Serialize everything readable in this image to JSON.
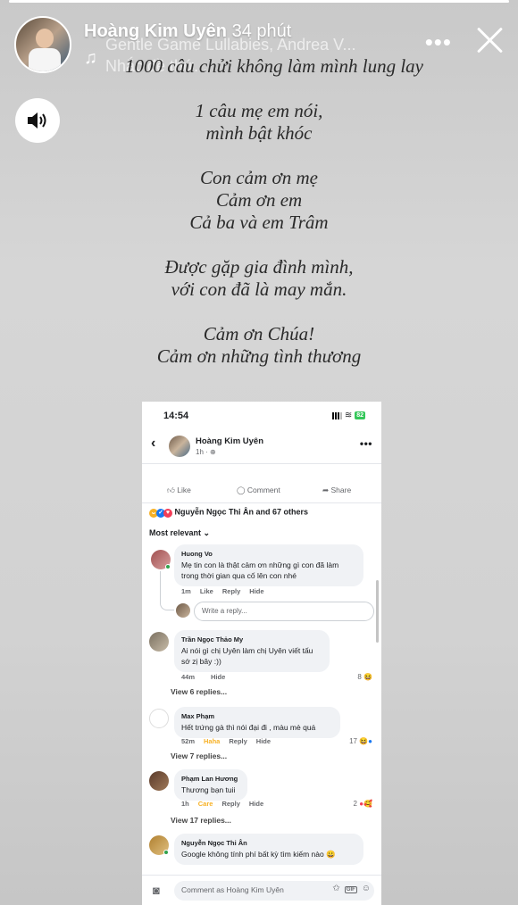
{
  "story": {
    "progress": 1.0,
    "user_name": "Hoàng Kim Uyên",
    "time": "34 phút",
    "music_title": "Gentle Game Lullabies, Andrea V...",
    "music_subtitle": "Nhắc đề thứ...",
    "more_label": "•••",
    "icons": {
      "music": "music-note-icon",
      "more": "more-horizontal-icon",
      "close": "close-icon",
      "sound": "speaker-icon"
    }
  },
  "poem": [
    [
      "1000 câu chửi không làm mình lung lay"
    ],
    [
      "1 câu mẹ em nói,",
      "mình bật khóc"
    ],
    [
      "Con cảm ơn mẹ",
      "Cảm ơn em",
      "Cả ba và em Trâm"
    ],
    [
      "Được gặp gia đình mình,",
      "với con đã là may mắn."
    ],
    [
      "Cảm ơn Chúa!",
      "Cảm ơn những tình thương"
    ]
  ],
  "phone": {
    "status_time": "14:54",
    "battery": "82",
    "post": {
      "author": "Hoàng Kim Uyên",
      "meta": "1h · ⊕",
      "back": "‹",
      "more": "•••"
    },
    "actions": {
      "like": "Like",
      "comment": "Comment",
      "share": "Share"
    },
    "reactions_text": "Nguyễn Ngọc Thi Ân and 67 others",
    "sort_label": "Most relevant",
    "comments": [
      {
        "name": "Huong Vo",
        "text": "Mẹ tin con là thật cảm ơn những gì con đã làm trong thời gian qua cố lên con nhé",
        "time": "1m",
        "like": "Like",
        "reply": "Reply",
        "hide": "Hide",
        "reaction_count": "",
        "replies": ""
      },
      {
        "name": "Trần Ngọc Thảo My",
        "text": "Ai nói gì chị Uyên làm chị Uyên viết tấu sớ zị bây :))",
        "time": "44m",
        "like": "",
        "reply": "",
        "hide": "Hide",
        "reaction_count": "8",
        "replies": "View 6 replies..."
      },
      {
        "name": "Max Phạm",
        "text": "Hết trứng gà thì nói đại đi , màu mè quá",
        "time": "52m",
        "like": "Haha",
        "reply": "Reply",
        "hide": "Hide",
        "reaction_count": "17",
        "replies": "View 7 replies..."
      },
      {
        "name": "Phạm Lan Hương",
        "text": "Thương bạn tuii",
        "time": "1h",
        "like": "Care",
        "reply": "Reply",
        "hide": "Hide",
        "reaction_count": "2",
        "replies": "View 17 replies..."
      },
      {
        "name": "Nguyễn Ngọc Thi Ân",
        "text": "Google không tính phí bất kỳ tìm kiếm nào 😀",
        "time": "",
        "like": "",
        "reply": "",
        "hide": "",
        "reaction_count": "",
        "replies": ""
      }
    ],
    "reply_placeholder": "Write a reply...",
    "comment_placeholder": "Comment as Hoàng Kim Uyên",
    "colors": {
      "haha": "#f7b125",
      "care": "#f7b125",
      "like_blue": "#1877f2",
      "love_red": "#f33e58",
      "online": "#31a24c"
    }
  }
}
